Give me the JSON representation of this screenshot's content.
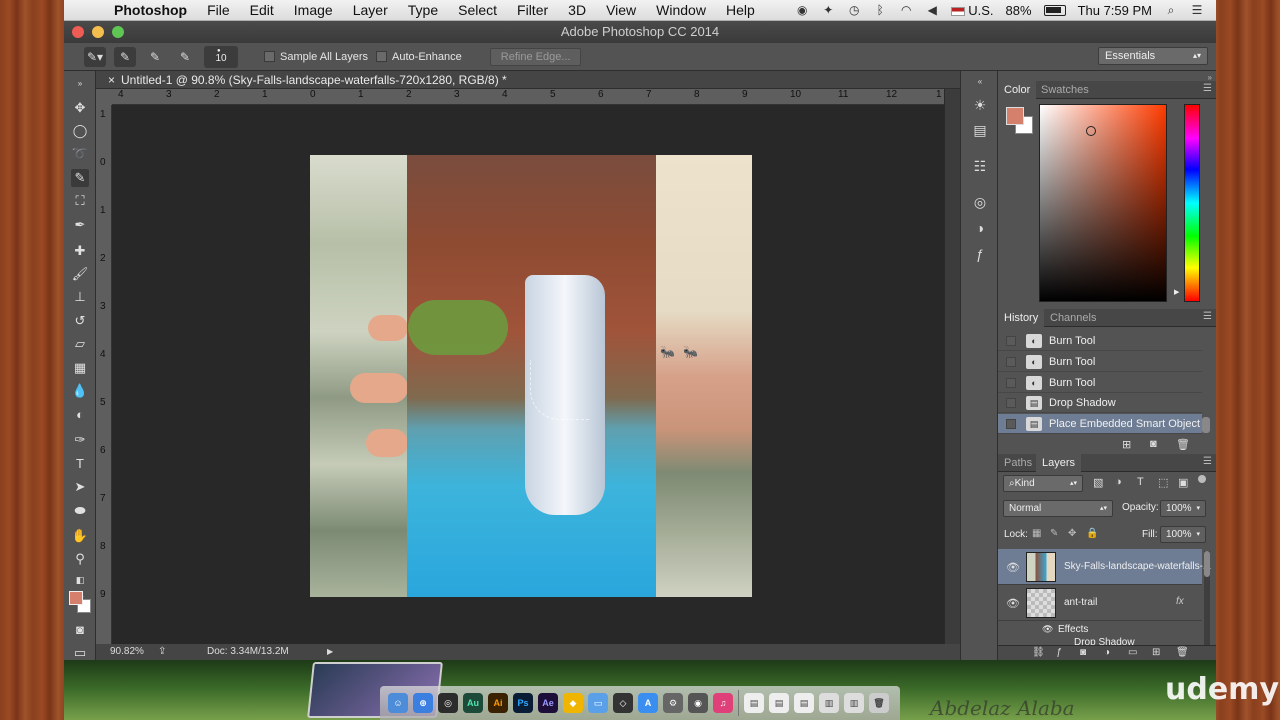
{
  "menubar": {
    "app": "Photoshop",
    "items": [
      "File",
      "Edit",
      "Image",
      "Layer",
      "Type",
      "Select",
      "Filter",
      "3D",
      "View",
      "Window",
      "Help"
    ],
    "locale": "U.S.",
    "battery": "88%",
    "clock": "Thu 7:59 PM"
  },
  "window": {
    "title": "Adobe Photoshop CC 2014"
  },
  "options": {
    "brush_size": "10",
    "sample_all_layers": "Sample All Layers",
    "auto_enhance": "Auto-Enhance",
    "refine_edge": "Refine Edge...",
    "workspace": "Essentials"
  },
  "document": {
    "tab_title": "Untitled-1 @ 90.8% (Sky-Falls-landscape-waterfalls-720x1280, RGB/8) *",
    "ruler_h": [
      "4",
      "3",
      "2",
      "1",
      "0",
      "1",
      "2",
      "3",
      "4",
      "5",
      "6",
      "7",
      "8",
      "9",
      "10",
      "11",
      "12",
      "1"
    ],
    "ruler_v": [
      "1",
      "0",
      "1",
      "2",
      "3",
      "4",
      "5",
      "6",
      "7",
      "8",
      "9"
    ]
  },
  "status": {
    "zoom": "90.82%",
    "doc": "Doc: 3.34M/13.2M"
  },
  "color_panel": {
    "tabs": [
      "Color",
      "Swatches"
    ],
    "foreground": "#d4806d",
    "background": "#ffffff"
  },
  "history_panel": {
    "tabs": [
      "History",
      "Channels"
    ],
    "rows": [
      "Burn Tool",
      "Burn Tool",
      "Burn Tool",
      "Drop Shadow",
      "Place Embedded Smart Object"
    ]
  },
  "layers_panel": {
    "tabs": [
      "Paths",
      "Layers"
    ],
    "filter": "Kind",
    "blend_mode": "Normal",
    "opacity_label": "Opacity:",
    "opacity": "100%",
    "lock_label": "Lock:",
    "fill_label": "Fill:",
    "fill": "100%",
    "layers": [
      {
        "name": "Sky-Falls-landscape-waterfalls-..."
      },
      {
        "name": "ant-trail",
        "fx": "fx"
      }
    ],
    "effects_label": "Effects",
    "effect_item": "Drop Shadow"
  },
  "dock_apps": [
    "Au",
    "Ai",
    "Ps",
    "Ae"
  ],
  "watermark": "udemy",
  "signature": "Abdelaz Alaba"
}
